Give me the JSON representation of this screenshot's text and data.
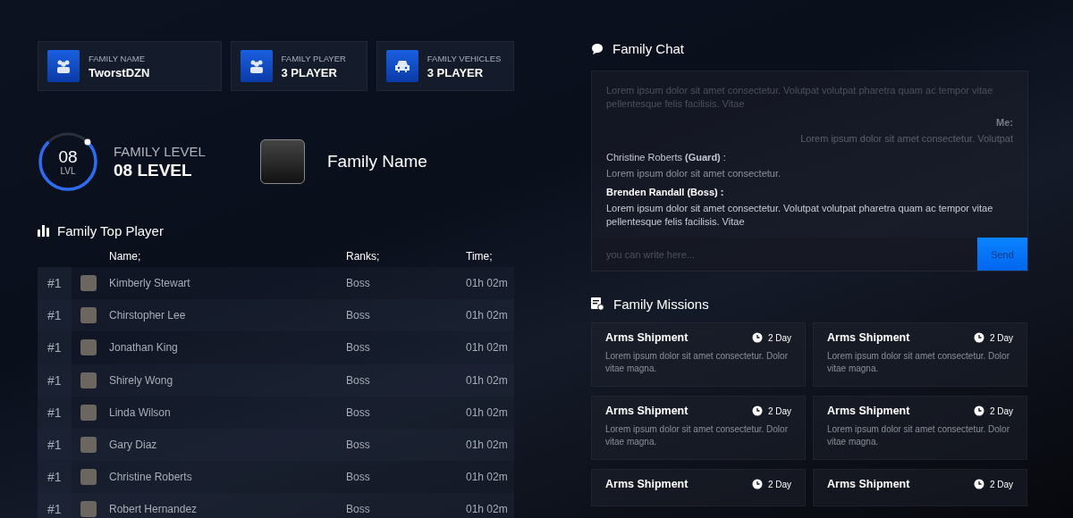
{
  "stats": [
    {
      "label": "FAMILY NAME",
      "value": "TworstDZN"
    },
    {
      "label": "FAMILY PLAYER",
      "value": "3 PLAYER"
    },
    {
      "label": "FAMILY VEHICLES",
      "value": "3 PLAYER"
    }
  ],
  "level": {
    "number": "08",
    "unit": "LVL",
    "label": "FAMILY LEVEL",
    "value": "08 LEVEL",
    "level": 0.75
  },
  "family": {
    "name": "Family Name"
  },
  "top_players": {
    "title": "Family Top Player",
    "columns": [
      "Name;",
      "Ranks;",
      "Time;"
    ],
    "rows": [
      {
        "rank": "#1",
        "name": "Kimberly Stewart",
        "role": "Boss",
        "time": "01h 02m"
      },
      {
        "rank": "#1",
        "name": "Chirstopher Lee",
        "role": "Boss",
        "time": "01h 02m"
      },
      {
        "rank": "#1",
        "name": "Jonathan King",
        "role": "Boss",
        "time": "01h 02m"
      },
      {
        "rank": "#1",
        "name": "Shirely Wong",
        "role": "Boss",
        "time": "01h 02m"
      },
      {
        "rank": "#1",
        "name": "Linda Wilson",
        "role": "Boss",
        "time": "01h 02m"
      },
      {
        "rank": "#1",
        "name": "Gary Diaz",
        "role": "Boss",
        "time": "01h 02m"
      },
      {
        "rank": "#1",
        "name": "Christine Roberts",
        "role": "Boss",
        "time": "01h 02m"
      },
      {
        "rank": "#1",
        "name": "Robert Hernandez",
        "role": "Boss",
        "time": "01h 02m"
      }
    ]
  },
  "chat": {
    "title": "Family Chat",
    "messages": [
      {
        "kind": "faded",
        "text": "Lorem ipsum dolor sit amet consectetur. Volutpat volutpat pharetra quam ac tempor vitae pellentesque felis facilisis. Vitae"
      },
      {
        "kind": "own",
        "sender": "Me:",
        "text": "Lorem ipsum dolor sit amet consectetur. Volutpat"
      },
      {
        "kind": "normal",
        "sender": "Christine Roberts **(Guard)** :",
        "text": "Lorem ipsum dolor sit amet consectetur."
      },
      {
        "kind": "recent",
        "sender": "Brenden Randall (Boss) :",
        "text": "Lorem ipsum dolor sit amet consectetur. Volutpat volutpat pharetra quam ac tempor vitae pellentesque felis facilisis. Vitae"
      }
    ],
    "input": {
      "placeholder": "you can write here..."
    },
    "send": "Send"
  },
  "missions": {
    "title": "Family Missions",
    "items": [
      {
        "title": "Arms Shipment",
        "time": "2 Day",
        "description": "Lorem ipsum dolor sit amet consectetur. Dolor vitae magna."
      },
      {
        "title": "Arms Shipment",
        "time": "2 Day",
        "description": "Lorem ipsum dolor sit amet consectetur. Dolor vitae magna."
      },
      {
        "title": "Arms Shipment",
        "time": "2 Day",
        "description": "Lorem ipsum dolor sit amet consectetur. Dolor vitae magna."
      },
      {
        "title": "Arms Shipment",
        "time": "2 Day",
        "description": "Lorem ipsum dolor sit amet consectetur. Dolor vitae magna."
      },
      {
        "title": "Arms Shipment",
        "time": "2 Day"
      },
      {
        "title": "Arms Shipment",
        "time": "2 Day"
      }
    ]
  }
}
